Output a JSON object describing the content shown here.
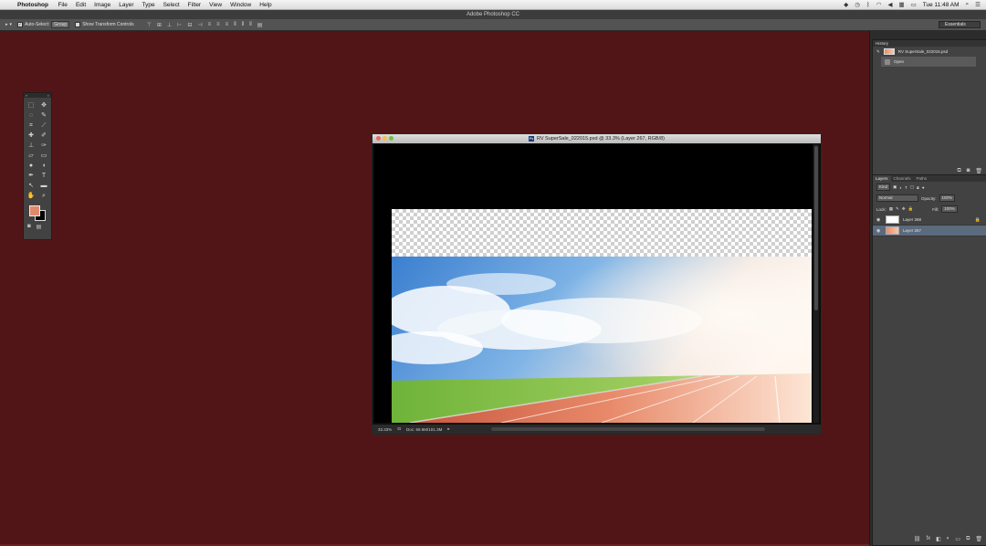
{
  "menubar": {
    "app_name": "Photoshop",
    "items": [
      "File",
      "Edit",
      "Image",
      "Layer",
      "Type",
      "Select",
      "Filter",
      "View",
      "Window",
      "Help"
    ],
    "clock": "Tue 11:48 AM"
  },
  "window_title": "Adobe Photoshop CC",
  "options_bar": {
    "auto_select_label": "Auto-Select:",
    "auto_select_value": "Group",
    "transform_label": "Show Transform Controls",
    "workspace": "Essentials"
  },
  "document": {
    "title": "RV SuperSale_022015.psd @ 33.3% (Layer 267, RGB/8)",
    "zoom": "33.33%",
    "doc_size": "Doc: 69.9M/101.3M"
  },
  "history": {
    "tab": "History",
    "snapshot": "RV SuperSale_022015.psd",
    "states": [
      "Open"
    ]
  },
  "layers_panel": {
    "tabs": [
      "Layers",
      "Channels",
      "Paths"
    ],
    "kind": "Kind",
    "blend_mode": "Normal",
    "opacity_label": "Opacity:",
    "opacity": "100%",
    "lock_label": "Lock:",
    "fill_label": "Fill:",
    "fill": "100%",
    "layers": [
      {
        "name": "Layer 268",
        "locked": true
      },
      {
        "name": "Layer 267",
        "selected": true
      }
    ]
  },
  "colors": {
    "foreground": "#e08a6a",
    "background": "#000000",
    "workspace_bg": "#521517"
  }
}
